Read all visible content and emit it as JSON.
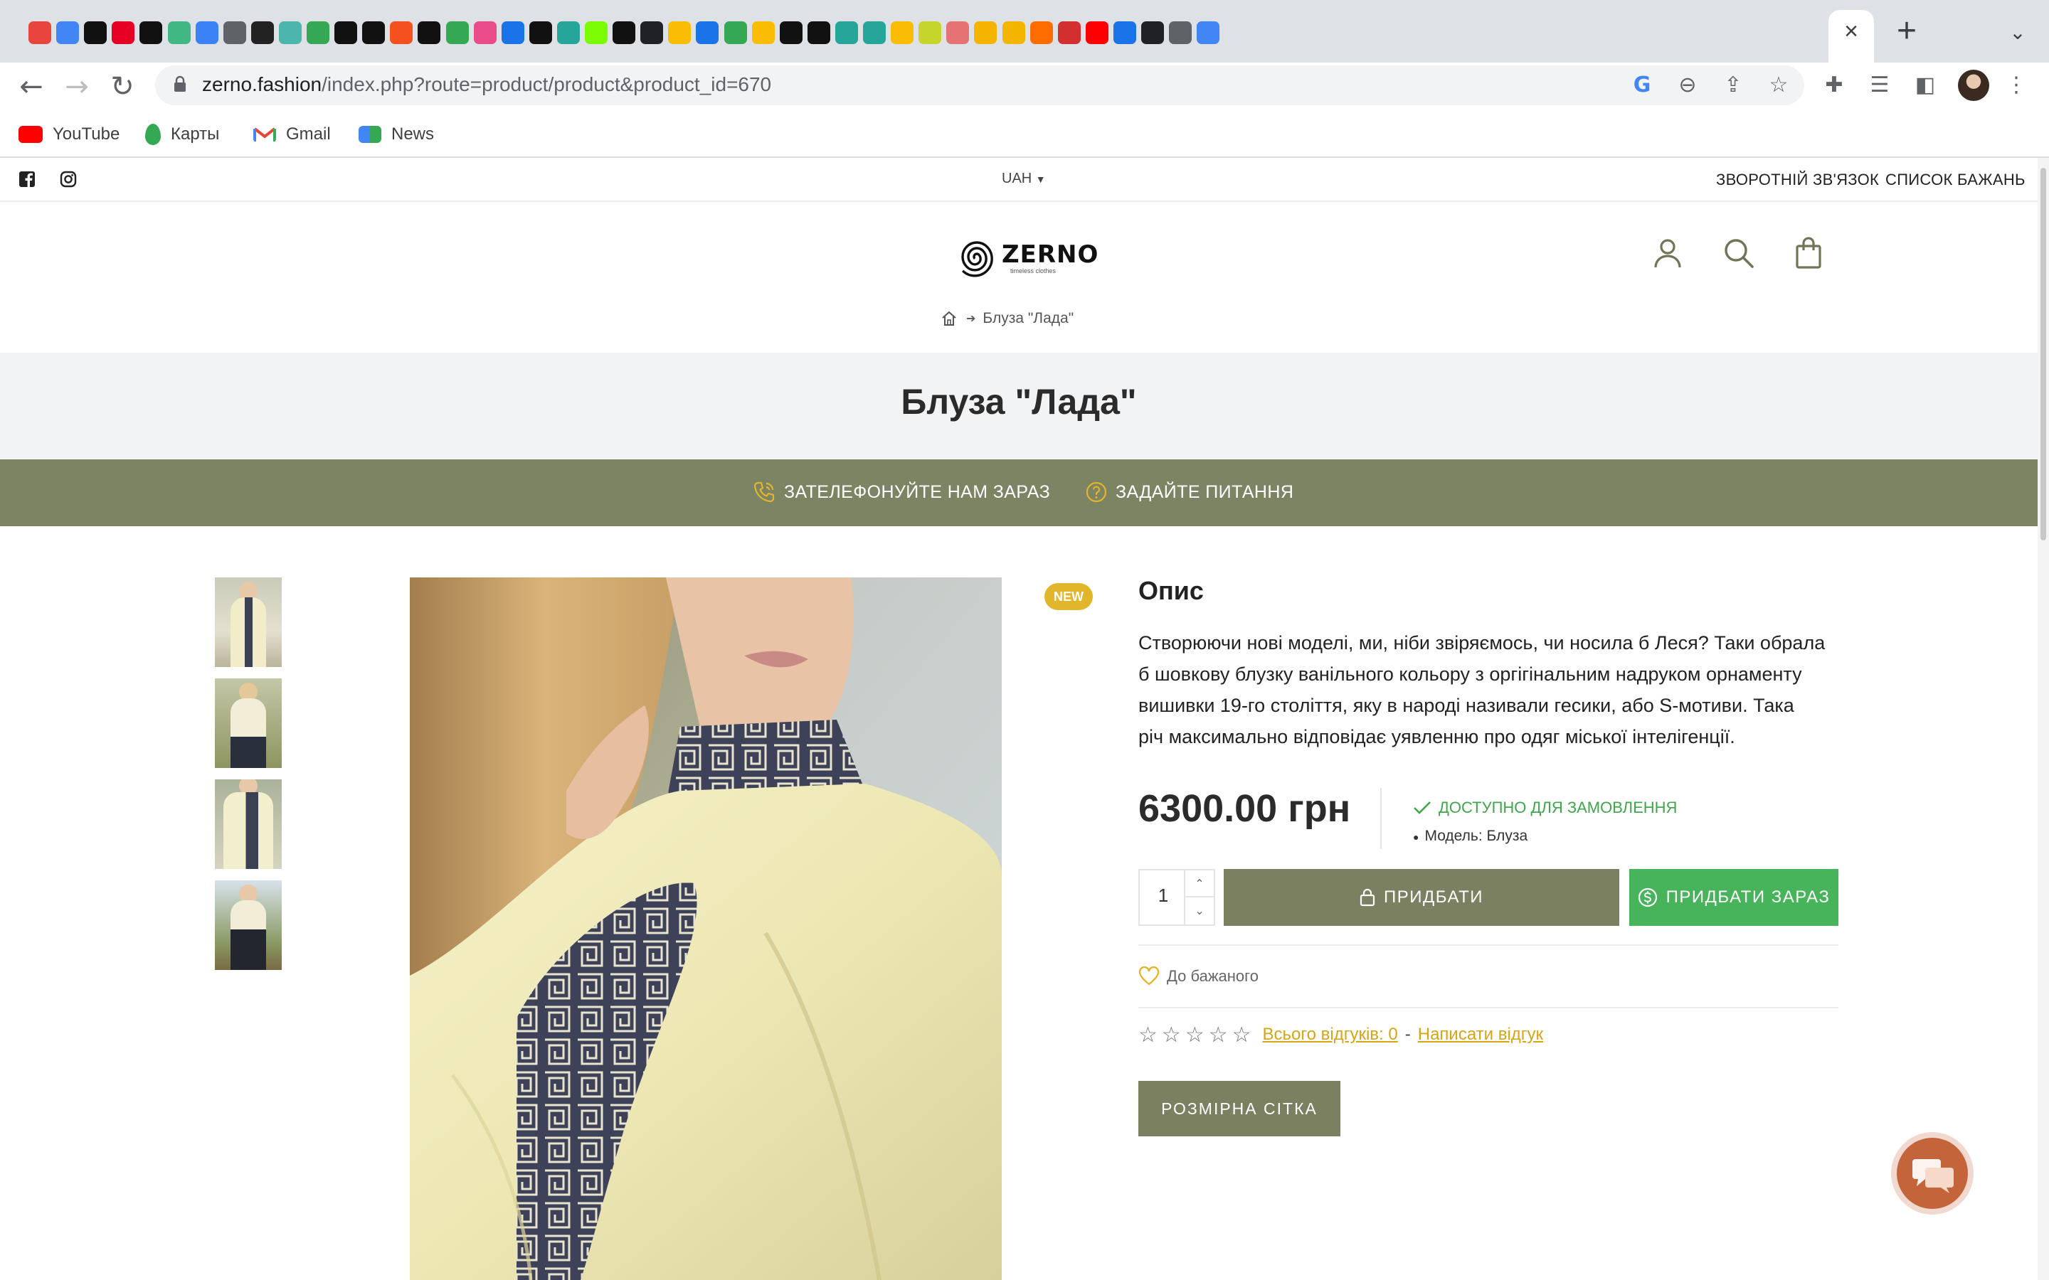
{
  "browser": {
    "tabs": [
      {
        "icon": "pin-icon",
        "color": "#e8453c"
      },
      {
        "icon": "google-translate-icon",
        "color": "#4285f4"
      },
      {
        "icon": "unsplash-icon",
        "color": "#111111"
      },
      {
        "icon": "pinterest-icon",
        "color": "#e60023"
      },
      {
        "icon": "triangle-icon",
        "color": "#111111"
      },
      {
        "icon": "vue-icon",
        "color": "#41b883"
      },
      {
        "icon": "feather-icon",
        "color": "#3b82f6"
      },
      {
        "icon": "globe-icon",
        "color": "#5f6368"
      },
      {
        "icon": "box-icon",
        "color": "#222222"
      },
      {
        "icon": "m-circle-icon",
        "color": "#4db6ac"
      },
      {
        "icon": "map-pin-icon",
        "color": "#34a853"
      },
      {
        "icon": "k-icon",
        "color": "#111111"
      },
      {
        "icon": "pp-icon",
        "color": "#111111"
      },
      {
        "icon": "multicolor-icon",
        "color": "#f4511e"
      },
      {
        "icon": "face-icon",
        "color": "#111111"
      },
      {
        "icon": "phone-frame-icon",
        "color": "#34a853"
      },
      {
        "icon": "dribbble-icon",
        "color": "#ea4c89"
      },
      {
        "icon": "info-icon",
        "color": "#1a73e8"
      },
      {
        "icon": "v-icon",
        "color": "#111111"
      },
      {
        "icon": "shell-icon",
        "color": "#26a69a"
      },
      {
        "icon": "lambda-icon",
        "color": "#7cfc00"
      },
      {
        "icon": "dots-icon",
        "color": "#111111"
      },
      {
        "icon": "play-circle-icon",
        "color": "#202124"
      },
      {
        "icon": "drive-icon",
        "color": "#fbbc04"
      },
      {
        "icon": "info-icon",
        "color": "#1a73e8"
      },
      {
        "icon": "check-circle-icon",
        "color": "#34a853"
      },
      {
        "icon": "emoji-icon",
        "color": "#fbbc04"
      },
      {
        "icon": "m-icon",
        "color": "#111111"
      },
      {
        "icon": "grid-icon",
        "color": "#111111"
      },
      {
        "icon": "shell-icon",
        "color": "#26a69a"
      },
      {
        "icon": "shell-icon",
        "color": "#26a69a"
      },
      {
        "icon": "drive-icon",
        "color": "#fbbc04"
      },
      {
        "icon": "alert-icon",
        "color": "#c6d52b"
      },
      {
        "icon": "fw-icon",
        "color": "#e57373"
      },
      {
        "icon": "v-shape-icon",
        "color": "#f4b400"
      },
      {
        "icon": "crown-icon",
        "color": "#f4b400"
      },
      {
        "icon": "fc-icon",
        "color": "#ff6d00"
      },
      {
        "icon": "rb-icon",
        "color": "#d32f2f"
      },
      {
        "icon": "youtube-icon",
        "color": "#ff0000"
      },
      {
        "icon": "c-icon",
        "color": "#1a73e8"
      },
      {
        "icon": "play-circle-icon",
        "color": "#202124"
      },
      {
        "icon": "speaker-icon",
        "color": "#5f6368"
      },
      {
        "icon": "globe-flag-icon",
        "color": "#4285f4"
      }
    ],
    "url_host": "zerno.fashion",
    "url_path": "/index.php?route=product/product&product_id=670",
    "bookmarks": [
      {
        "label": "YouTube",
        "icon": "youtube-icon",
        "color": "#ff0000"
      },
      {
        "label": "Карты",
        "icon": "maps-pin-icon",
        "color": "#34a853"
      },
      {
        "label": "Gmail",
        "icon": "gmail-icon",
        "color": "#ea4335"
      },
      {
        "label": "News",
        "icon": "news-icon",
        "color": "#4285f4"
      }
    ]
  },
  "site": {
    "currency": "UAH",
    "top_links": {
      "feedback": "ЗВОРОТНІЙ ЗВ'ЯЗОК",
      "wishlist": "СПИСОК БАЖАНЬ"
    },
    "logo": {
      "name": "ZERNO",
      "tagline": "timeless clothes"
    },
    "breadcrumb": {
      "current": "Блуза \"Лада\""
    },
    "page_title": "Блуза \"Лада\"",
    "band": {
      "call": "ЗАТЕЛЕФОНУЙТЕ НАМ ЗАРАЗ",
      "ask": "ЗАДАЙТЕ ПИТАННЯ"
    },
    "colors": {
      "olive": "#7d8463",
      "green": "#47b35a",
      "gold": "#e2b62a",
      "link": "#d7a416"
    }
  },
  "product": {
    "badge": "NEW",
    "desc_title": "Опис",
    "desc_lines": [
      "Створюючи нові моделі, ми, ніби звіряємось, чи носила б Леся? Таки обрала",
      "б шовкову блузку ванільного кольору з оргігінальним надруком орнаменту",
      "вишивки 19-го століття, яку в народі називали гесики, або S-мотиви. Така",
      "річ максимально відповідає уявленню про одяг міської інтелігенції."
    ],
    "price": "6300.00 грн",
    "stock": "ДОСТУПНО ДЛЯ ЗАМОВЛЕННЯ",
    "model": "Модель: Блуза",
    "qty": "1",
    "add_label": "ПРИДБАТИ",
    "buy_label": "ПРИДБАТИ ЗАРАЗ",
    "wishlist_label": "До бажаного",
    "rating_stars": 0,
    "reviews_label": "Всього відгуків: 0",
    "reviews_sep": "-",
    "write_review": "Написати відгук",
    "size_chart": "РОЗМІРНА СІТКА"
  }
}
